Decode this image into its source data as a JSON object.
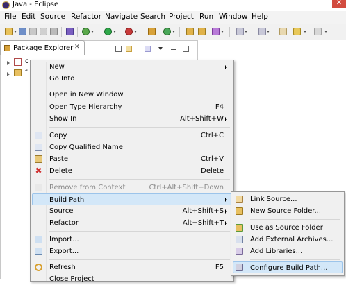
{
  "window": {
    "title": "Java - Eclipse",
    "close_glyph": "✕"
  },
  "menubar": [
    "File",
    "Edit",
    "Source",
    "Refactor",
    "Navigate",
    "Search",
    "Project",
    "Run",
    "Window",
    "Help"
  ],
  "view": {
    "tab_label": "Package Explorer",
    "tab_close_glyph": "✕",
    "tree_items": [
      "c",
      "f"
    ]
  },
  "context_menu": {
    "items": [
      {
        "label": "New",
        "submenu": true
      },
      {
        "label": "Go Into"
      },
      {
        "label": "Open in New Window"
      },
      {
        "label": "Open Type Hierarchy",
        "accel": "F4"
      },
      {
        "label": "Show In",
        "accel": "Alt+Shift+W",
        "submenu": true
      },
      {
        "label": "Copy",
        "accel": "Ctrl+C",
        "icon": "copy-icon"
      },
      {
        "label": "Copy Qualified Name",
        "icon": "copy-qualified-name-icon"
      },
      {
        "label": "Paste",
        "accel": "Ctrl+V",
        "icon": "paste-icon"
      },
      {
        "label": "Delete",
        "accel": "Delete",
        "icon": "delete-icon"
      },
      {
        "label": "Remove from Context",
        "accel": "Ctrl+Alt+Shift+Down",
        "icon": "remove-from-context-icon",
        "disabled": true
      },
      {
        "label": "Build Path",
        "submenu": true,
        "highlighted": true
      },
      {
        "label": "Source",
        "accel": "Alt+Shift+S",
        "submenu": true
      },
      {
        "label": "Refactor",
        "accel": "Alt+Shift+T",
        "submenu": true
      },
      {
        "label": "Import...",
        "icon": "import-icon"
      },
      {
        "label": "Export...",
        "icon": "export-icon"
      },
      {
        "label": "Refresh",
        "accel": "F5",
        "icon": "refresh-icon"
      },
      {
        "label": "Close Project"
      }
    ]
  },
  "submenu": {
    "items": [
      {
        "label": "Link Source...",
        "icon": "link-source-icon"
      },
      {
        "label": "New Source Folder...",
        "icon": "new-source-folder-icon"
      },
      {
        "label": "Use as Source Folder",
        "icon": "use-as-source-folder-icon"
      },
      {
        "label": "Add External Archives...",
        "icon": "add-external-archives-icon"
      },
      {
        "label": "Add Libraries...",
        "icon": "add-libraries-icon"
      },
      {
        "label": "Configure Build Path...",
        "icon": "configure-build-path-icon",
        "highlighted": true
      }
    ]
  }
}
